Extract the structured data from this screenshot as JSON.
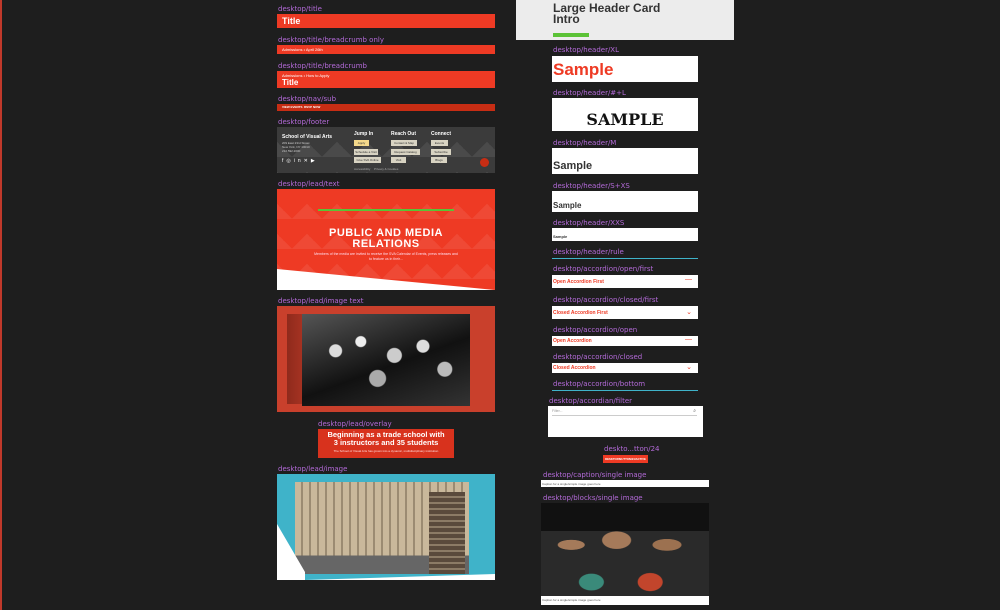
{
  "labels": {
    "title": "desktop/title",
    "title_breadcrumb_only": "desktop/title/breadcrumb only",
    "title_breadcrumb": "desktop/title/breadcrumb",
    "nav_sub": "desktop/nav/sub",
    "footer": "desktop/footer",
    "lead_text": "desktop/lead/text",
    "lead_image_text": "desktop/lead/image text",
    "lead_overlay": "desktop/lead/overlay",
    "lead_image": "desktop/lead/image",
    "header_xl": "desktop/header/XL",
    "header_hl": "desktop/header/#+L",
    "header_m": "desktop/header/M",
    "header_sxs": "desktop/header/S+XS",
    "header_xxs": "desktop/header/XXS",
    "header_rule": "desktop/header/rule",
    "acc_open_first": "desktop/accordion/open/first",
    "acc_closed_first": "desktop/accordion/closed/first",
    "acc_open": "desktop/accordion/open",
    "acc_closed": "desktop/accordion/closed",
    "acc_bottom": "desktop/accordion/bottom",
    "acc_filter": "desktop/accordian/filter",
    "button24": "deskto...tton/24",
    "caption_single": "desktop/caption/single image",
    "blocks_single": "desktop/blocks/single image"
  },
  "title": {
    "text": "Title"
  },
  "breadcrumb_only": {
    "text": "Admissions • April 26th"
  },
  "title_breadcrumb": {
    "crumb": "Admissions • How to Apply",
    "text": "Title"
  },
  "nav_sub": {
    "items": [
      "VIEW EVENTS",
      "RSVP NOW"
    ]
  },
  "footer": {
    "school": "School of Visual Arts",
    "address": [
      "209 East 23rd Street",
      "New York, NY 10010",
      "212.592.2000"
    ],
    "columns": [
      {
        "heading": "Jump In",
        "buttons": [
          "Apply",
          "Schedule a Visit",
          "Give SVA Online"
        ]
      },
      {
        "heading": "Reach Out",
        "buttons": [
          "Contact & Map",
          "Request Catalog",
          "Visit"
        ]
      },
      {
        "heading": "Connect",
        "buttons": [
          "Events",
          "Subscribe",
          "Blogs"
        ]
      }
    ],
    "legal": [
      "Accessibility",
      "Privacy & Cookies"
    ]
  },
  "lead_text": {
    "heading_line1": "PUBLIC AND MEDIA",
    "heading_line2": "RELATIONS",
    "body": "Members of the media are invited to receive the SVA Calendar of Events, press releases and to feature us in their..."
  },
  "lead_overlay": {
    "line1": "Beginning as a trade school with",
    "line2": "3 instructors and 35 students",
    "sub": "The School of Visual Arts has grown into a dynamic, multidisciplinary institution"
  },
  "header_card": {
    "line1": "Large Header Card",
    "line2": "Intro"
  },
  "header_xl": {
    "text": "Sample"
  },
  "header_hl": {
    "text": "SAMPLE"
  },
  "header_m": {
    "text": "Sample"
  },
  "header_sxs": {
    "text": "Sample"
  },
  "header_xxs": {
    "text": "Sample"
  },
  "accordion": {
    "open_first": "Open Accordion First",
    "closed_first": "Closed Accordion First",
    "open": "Open Accordion",
    "closed": "Closed Accordion"
  },
  "filter": {
    "placeholder": "Filter..."
  },
  "button24": {
    "label": "DESKTOP/BUTTON/24/ACTIVE"
  },
  "caption": {
    "text": "Caption for a single/simple image goes here"
  },
  "blocks_caption": {
    "text": "Caption for a single/simple image goes here"
  },
  "colors": {
    "accent": "#ee3a24",
    "label": "#b36ad8",
    "background": "#1e1e1e",
    "green": "#5bc236"
  }
}
